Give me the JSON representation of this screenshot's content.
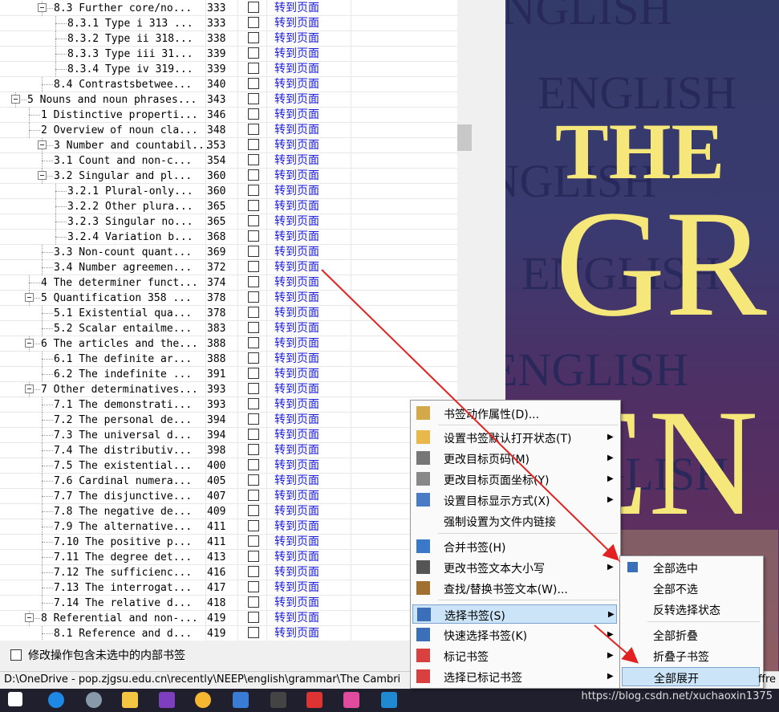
{
  "tree_rows": [
    {
      "label": "8.3 Further core/no...",
      "page": "333",
      "indent": 67,
      "expand": true
    },
    {
      "label": "8.3.1 Type i 313 ...",
      "page": "333",
      "indent": 84
    },
    {
      "label": "8.3.2 Type ii 318...",
      "page": "338",
      "indent": 84
    },
    {
      "label": "8.3.3 Type iii 31...",
      "page": "339",
      "indent": 84
    },
    {
      "label": "8.3.4 Type iv 319...",
      "page": "339",
      "indent": 84
    },
    {
      "label": "8.4 Contrastsbetwee...",
      "page": "340",
      "indent": 67
    },
    {
      "label": "5 Nouns and noun phrases...",
      "page": "343",
      "indent": 34,
      "expand": true
    },
    {
      "label": "1 Distinctive properti...",
      "page": "346",
      "indent": 51
    },
    {
      "label": "2 Overview of noun cla...",
      "page": "348",
      "indent": 51
    },
    {
      "label": "3 Number and countabil...",
      "page": "353",
      "indent": 67,
      "expand": true
    },
    {
      "label": "3.1 Count and non-c...",
      "page": "354",
      "indent": 67
    },
    {
      "label": "3.2 Singular and pl...",
      "page": "360",
      "indent": 67,
      "expand": true
    },
    {
      "label": "3.2.1 Plural-only...",
      "page": "360",
      "indent": 84
    },
    {
      "label": "3.2.2 Other plura...",
      "page": "365",
      "indent": 84
    },
    {
      "label": "3.2.3 Singular no...",
      "page": "365",
      "indent": 84
    },
    {
      "label": "3.2.4 Variation b...",
      "page": "368",
      "indent": 84
    },
    {
      "label": "3.3 Non-count quant...",
      "page": "369",
      "indent": 67
    },
    {
      "label": "3.4 Number agreemen...",
      "page": "372",
      "indent": 67
    },
    {
      "label": "4 The determiner funct...",
      "page": "374",
      "indent": 51
    },
    {
      "label": "5 Quantification 358 ...",
      "page": "378",
      "indent": 51,
      "expand": true
    },
    {
      "label": "5.1 Existential qua...",
      "page": "378",
      "indent": 67
    },
    {
      "label": "5.2 Scalar entailme...",
      "page": "383",
      "indent": 67
    },
    {
      "label": "6 The articles and the...",
      "page": "388",
      "indent": 51,
      "expand": true
    },
    {
      "label": "6.1 The definite ar...",
      "page": "388",
      "indent": 67
    },
    {
      "label": "6.2 The indefinite ...",
      "page": "391",
      "indent": 67
    },
    {
      "label": "7 Other determinatives...",
      "page": "393",
      "indent": 51,
      "expand": true
    },
    {
      "label": "7.1 The demonstrati...",
      "page": "393",
      "indent": 67
    },
    {
      "label": "7.2 The personal de...",
      "page": "394",
      "indent": 67
    },
    {
      "label": "7.3 The universal d...",
      "page": "394",
      "indent": 67
    },
    {
      "label": "7.4 The distributiv...",
      "page": "398",
      "indent": 67
    },
    {
      "label": "7.5 The existential...",
      "page": "400",
      "indent": 67
    },
    {
      "label": "7.6 Cardinal numera...",
      "page": "405",
      "indent": 67
    },
    {
      "label": "7.7 The disjunctive...",
      "page": "407",
      "indent": 67
    },
    {
      "label": "7.8 The negative de...",
      "page": "409",
      "indent": 67
    },
    {
      "label": "7.9 The alternative...",
      "page": "411",
      "indent": 67
    },
    {
      "label": "7.10 The positive p...",
      "page": "411",
      "indent": 67
    },
    {
      "label": "7.11 The degree det...",
      "page": "413",
      "indent": 67
    },
    {
      "label": "7.12 The sufficienc...",
      "page": "416",
      "indent": 67
    },
    {
      "label": "7.13 The interrogat...",
      "page": "417",
      "indent": 67
    },
    {
      "label": "7.14 The relative d...",
      "page": "418",
      "indent": 67
    },
    {
      "label": "8 Referential and non-...",
      "page": "419",
      "indent": 51,
      "expand": true
    },
    {
      "label": "8.1 Reference and d...",
      "page": "419",
      "indent": 67
    }
  ],
  "goto_link": "转到页面",
  "bottom_option": "修改操作包含未选中的内部书签",
  "status_path": "D:\\OneDrive - pop.zjgsu.edu.cn\\recently\\NEEP\\english\\grammar\\The Cambri",
  "status_tail": "ffre",
  "watermark": "https://blog.csdn.net/xuchaoxin1375",
  "cover": {
    "line1": "THE",
    "line2": "GR",
    "line3": "EN",
    "bg_word": "ENGLISH"
  },
  "context_menu": {
    "items": [
      {
        "label": "书签动作属性(D)...",
        "sub": false,
        "icon": "properties-icon"
      },
      {
        "label": "设置书签默认打开状态(T)",
        "sub": true,
        "icon": "folder-icon"
      },
      {
        "label": "更改目标页码(M)",
        "sub": true,
        "icon": "number-icon"
      },
      {
        "label": "更改目标页面坐标(Y)",
        "sub": true,
        "icon": "coordinate-icon"
      },
      {
        "label": "设置目标显示方式(X)",
        "sub": true,
        "icon": "zoom-icon"
      },
      {
        "label": "强制设置为文件内链接",
        "sub": false,
        "icon": ""
      },
      {
        "label": "合并书签(H)",
        "sub": false,
        "icon": "merge-icon"
      },
      {
        "label": "更改书签文本大小写",
        "sub": true,
        "icon": "case-icon"
      },
      {
        "label": "查找/替换书签文本(W)...",
        "sub": false,
        "icon": "find-icon"
      },
      {
        "label": "选择书签(S)",
        "sub": true,
        "icon": "select-icon",
        "highlighted": true
      },
      {
        "label": "快速选择书签(K)",
        "sub": true,
        "icon": "quick-select-icon"
      },
      {
        "label": "标记书签",
        "sub": true,
        "icon": "mark-icon"
      },
      {
        "label": "选择已标记书签",
        "sub": true,
        "icon": "marked-icon"
      }
    ]
  },
  "submenu": {
    "items": [
      {
        "label": "全部选中"
      },
      {
        "label": "全部不选"
      },
      {
        "label": "反转选择状态"
      },
      {
        "label": "全部折叠"
      },
      {
        "label": "折叠子书签"
      },
      {
        "label": "全部展开",
        "highlighted": true
      }
    ]
  },
  "colors": {
    "arrow": "#e22222",
    "link": "#1a1adf",
    "menu_highlight": "#cce4f7",
    "cover_text": "#f5e77a"
  }
}
